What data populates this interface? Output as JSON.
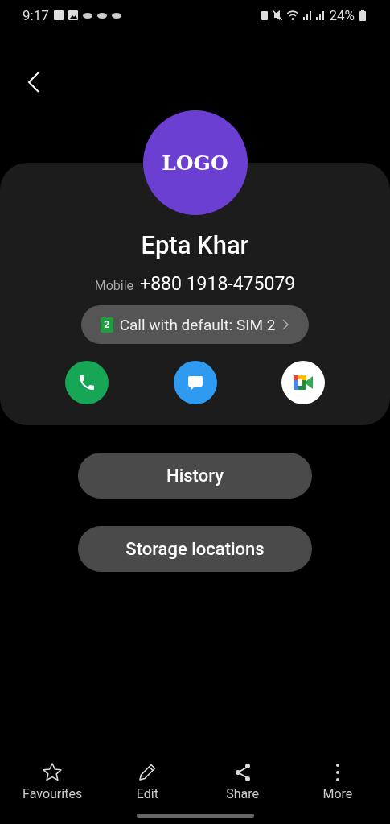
{
  "status_bar": {
    "time": "9:17",
    "battery": "24%"
  },
  "contact": {
    "avatar_text": "LOGO",
    "name": "Epta Khar",
    "phone_label": "Mobile",
    "phone": "+880 1918-475079",
    "sim_badge": "2",
    "call_default": "Call with default: SIM 2"
  },
  "actions": [
    {
      "kind": "call"
    },
    {
      "kind": "message"
    },
    {
      "kind": "video"
    }
  ],
  "buttons": [
    "History",
    "Storage locations"
  ],
  "bottom_bar": [
    {
      "kind": "star",
      "label": "Favourites"
    },
    {
      "kind": "edit",
      "label": "Edit"
    },
    {
      "kind": "share",
      "label": "Share"
    },
    {
      "kind": "more",
      "label": "More"
    }
  ]
}
